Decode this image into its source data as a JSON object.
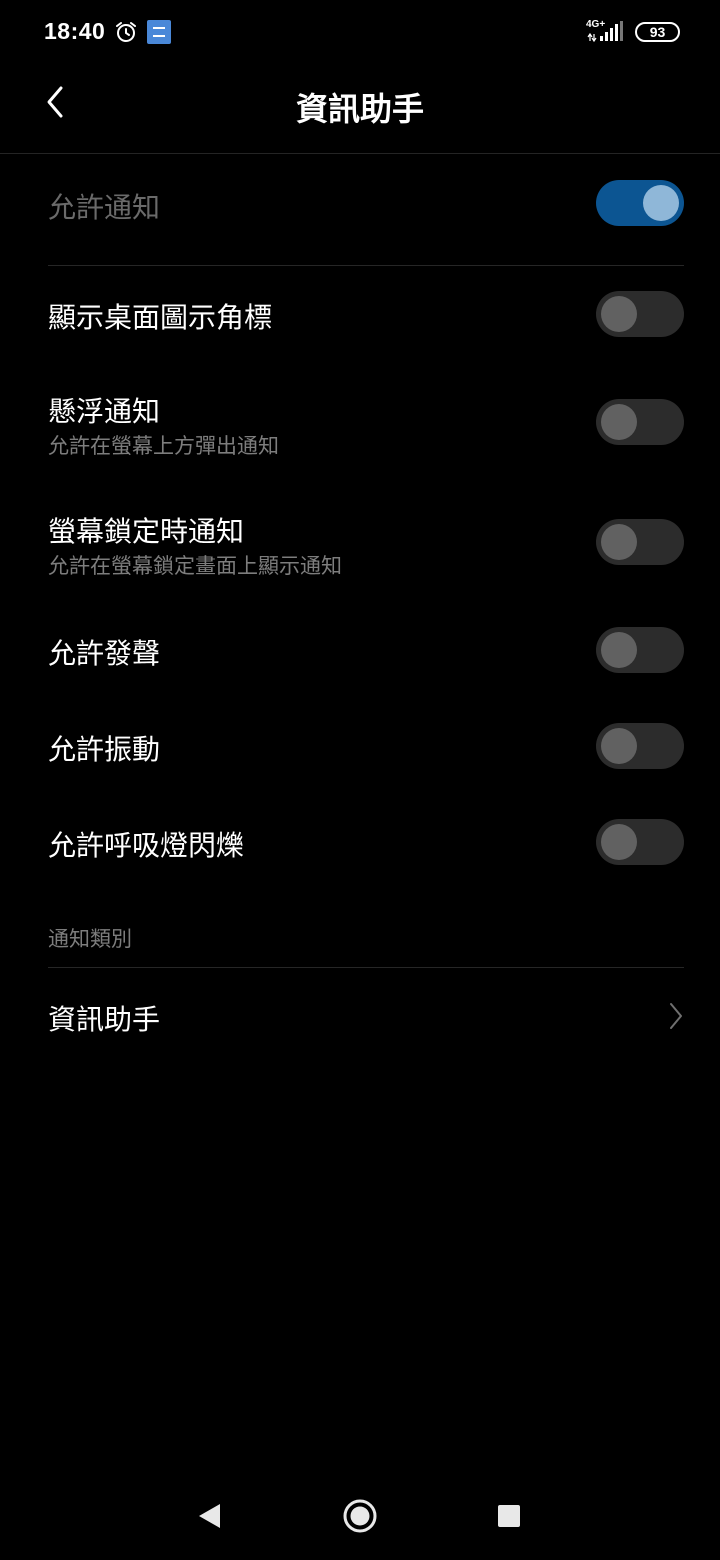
{
  "status_bar": {
    "time": "18:40",
    "network_type": "4G+",
    "battery_level": "93",
    "icons": [
      "alarm-clock-icon",
      "app-notification-icon",
      "signal-strength-icon",
      "battery-icon"
    ]
  },
  "header": {
    "title": "資訊助手",
    "back_icon": "chevron-left-icon"
  },
  "settings": [
    {
      "id": "allow-notifications",
      "title": "允許通知",
      "subtitle": "",
      "enabled": true,
      "disabled_look": true
    },
    {
      "id": "show-badge",
      "title": "顯示桌面圖示角標",
      "subtitle": "",
      "enabled": false
    },
    {
      "id": "floating-notifications",
      "title": "懸浮通知",
      "subtitle": "允許在螢幕上方彈出通知",
      "enabled": false
    },
    {
      "id": "lockscreen-notifications",
      "title": "螢幕鎖定時通知",
      "subtitle": "允許在螢幕鎖定畫面上顯示通知",
      "enabled": false
    },
    {
      "id": "allow-sound",
      "title": "允許發聲",
      "subtitle": "",
      "enabled": false
    },
    {
      "id": "allow-vibration",
      "title": "允許振動",
      "subtitle": "",
      "enabled": false
    },
    {
      "id": "allow-led-blink",
      "title": "允許呼吸燈閃爍",
      "subtitle": "",
      "enabled": false
    }
  ],
  "categories": {
    "section_label": "通知類別",
    "items": [
      {
        "title": "資訊助手",
        "icon": "chevron-right-icon"
      }
    ]
  },
  "nav_bar": {
    "icons": [
      "nav-back-icon",
      "nav-home-icon",
      "nav-recents-icon"
    ]
  },
  "colors": {
    "background": "#000000",
    "toggle_on_track": "#0c5592",
    "toggle_on_knob": "#8fb7d8",
    "toggle_off_track": "#2c2c2c",
    "toggle_off_knob": "#616161",
    "secondary_text": "#7d7d7d"
  }
}
